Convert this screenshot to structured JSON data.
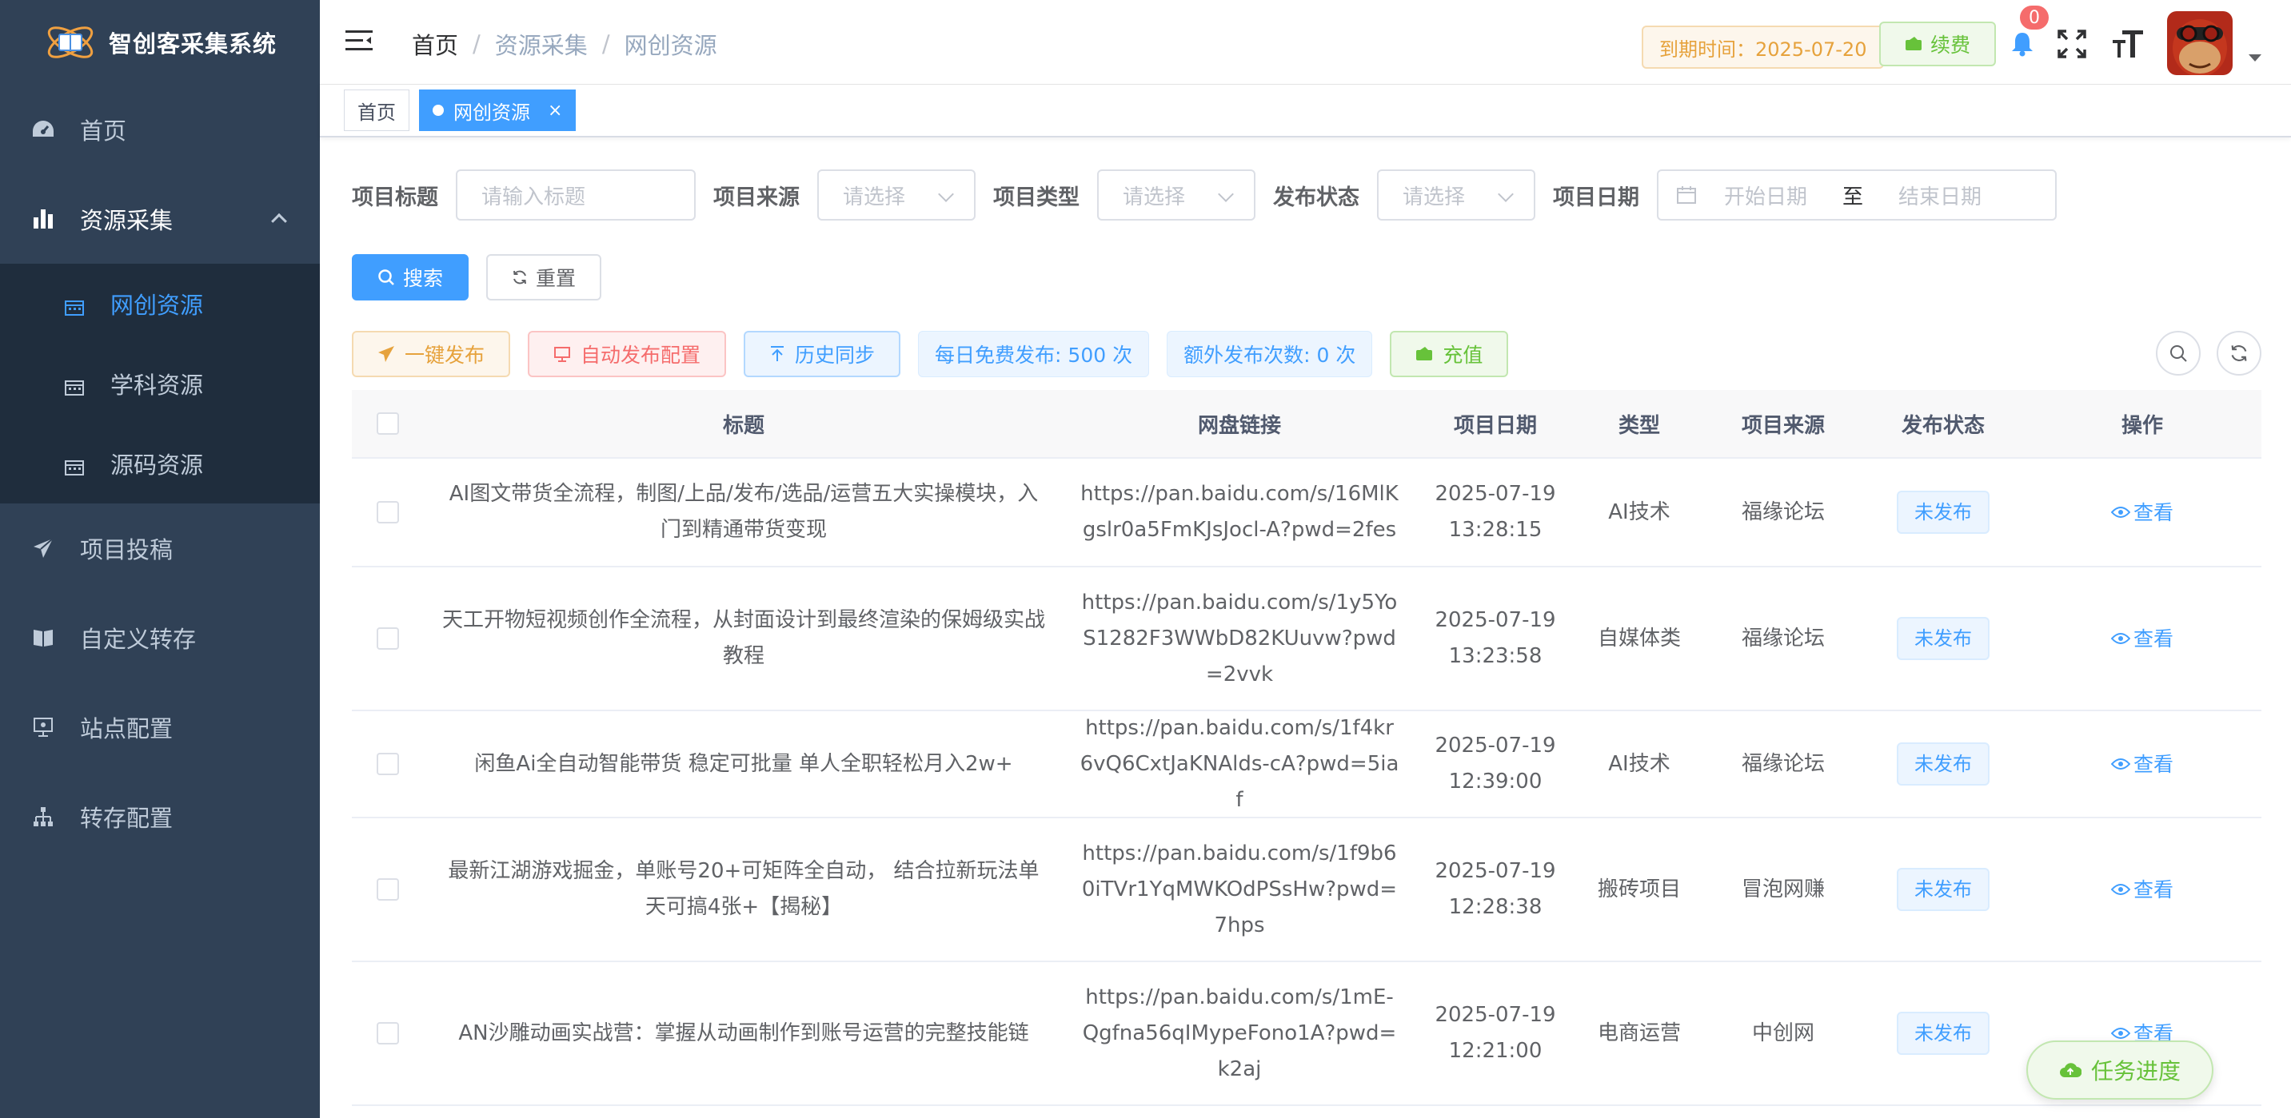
{
  "app": {
    "title": "智创客采集系统"
  },
  "sidebar": {
    "items": [
      {
        "label": "首页"
      },
      {
        "label": "资源采集"
      },
      {
        "label": "项目投稿"
      },
      {
        "label": "自定义转存"
      },
      {
        "label": "站点配置"
      },
      {
        "label": "转存配置"
      }
    ],
    "submenu": [
      {
        "label": "网创资源"
      },
      {
        "label": "学科资源"
      },
      {
        "label": "源码资源"
      }
    ]
  },
  "header": {
    "breadcrumb": [
      "首页",
      "资源采集",
      "网创资源"
    ],
    "breadcrumb_sep": "/",
    "expire": "到期时间：2025-07-20",
    "renew": "续费",
    "badge_count": "0"
  },
  "tags": {
    "home": "首页",
    "active": "网创资源",
    "close": "×"
  },
  "filters": {
    "title_label": "项目标题",
    "title_placeholder": "请输入标题",
    "source_label": "项目来源",
    "source_placeholder": "请选择",
    "type_label": "项目类型",
    "type_placeholder": "请选择",
    "status_label": "发布状态",
    "status_placeholder": "请选择",
    "date_label": "项目日期",
    "date_start": "开始日期",
    "date_sep": "至",
    "date_end": "结束日期"
  },
  "buttons": {
    "search": "搜索",
    "reset": "重置"
  },
  "actions": {
    "publish": "一键发布",
    "auto_config": "自动发布配置",
    "history_sync": "历史同步",
    "daily_free": "每日免费发布: 500 次",
    "extra": "额外发布次数: 0 次",
    "recharge": "充值"
  },
  "table": {
    "columns": [
      "标题",
      "网盘链接",
      "项目日期",
      "类型",
      "项目来源",
      "发布状态",
      "操作"
    ],
    "rows": [
      {
        "title": "AI图文带货全流程，制图/上品/发布/选品/运营五大实操模块，入门到精通带货变现",
        "link": "https://pan.baidu.com/s/16MlKgslr0a5FmKJsJocl-A?pwd=2fes",
        "date": "2025-07-19",
        "time": "13:28:15",
        "type": "AI技术",
        "source": "福缘论坛",
        "status": "未发布",
        "op": "查看"
      },
      {
        "title": "天工开物短视频创作全流程，从封面设计到最终渲染的保姆级实战教程",
        "link": "https://pan.baidu.com/s/1y5YoS1282F3WWbD82KUuvw?pwd=2vvk",
        "date": "2025-07-19",
        "time": "13:23:58",
        "type": "自媒体类",
        "source": "福缘论坛",
        "status": "未发布",
        "op": "查看"
      },
      {
        "title": "闲鱼Ai全自动智能带货 稳定可批量 单人全职轻松月入2w+",
        "link": "https://pan.baidu.com/s/1f4kr6vQ6CxtJaKNAlds-cA?pwd=5iaf",
        "date": "2025-07-19",
        "time": "12:39:00",
        "type": "AI技术",
        "source": "福缘论坛",
        "status": "未发布",
        "op": "查看"
      },
      {
        "title": "最新江湖游戏掘金，单账号20+可矩阵全自动， 结合拉新玩法单天可搞4张+【揭秘】",
        "link": "https://pan.baidu.com/s/1f9b60iTVr1YqMWKOdPSsHw?pwd=7hps",
        "date": "2025-07-19",
        "time": "12:28:38",
        "type": "搬砖项目",
        "source": "冒泡网赚",
        "status": "未发布",
        "op": "查看"
      },
      {
        "title": "AN沙雕动画实战营：掌握从动画制作到账号运营的完整技能链",
        "link": "https://pan.baidu.com/s/1mE-Qgfna56qIMypeFono1A?pwd=k2aj",
        "date": "2025-07-19",
        "time": "12:21:00",
        "type": "电商运营",
        "source": "中创网",
        "status": "未发布",
        "op": "查看"
      }
    ]
  },
  "float": {
    "task_progress": "任务进度"
  },
  "colors": {
    "sidebar": "#304156",
    "primary": "#409eff",
    "success": "#67c23a",
    "warning": "#e6a23c",
    "danger": "#f56c6c"
  }
}
